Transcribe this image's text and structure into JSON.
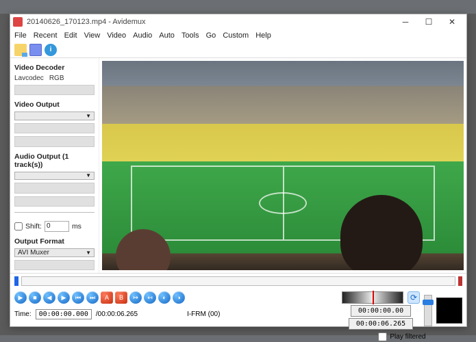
{
  "window": {
    "title": "20140626_170123.mp4 - Avidemux"
  },
  "menu": [
    "File",
    "Recent",
    "Edit",
    "View",
    "Video",
    "Audio",
    "Auto",
    "Tools",
    "Go",
    "Custom",
    "Help"
  ],
  "sidebar": {
    "video_decoder_label": "Video Decoder",
    "codec": "Lavcodec",
    "colorspace": "RGB",
    "video_output_label": "Video Output",
    "audio_output_label": "Audio Output (1 track(s))",
    "shift_label": "Shift:",
    "shift_value": "0",
    "shift_unit": "ms",
    "output_format_label": "Output Format",
    "output_format_value": "AVI Muxer"
  },
  "bottom": {
    "time_label": "Time:",
    "time_value": "00:00:00.000",
    "duration_value": "/00:00:06.265",
    "frame_label": "I-FRM (00)",
    "tc1": "00:00:00.00",
    "tc2": "00:00:06.265",
    "play_filtered_label": "Play filtered"
  }
}
